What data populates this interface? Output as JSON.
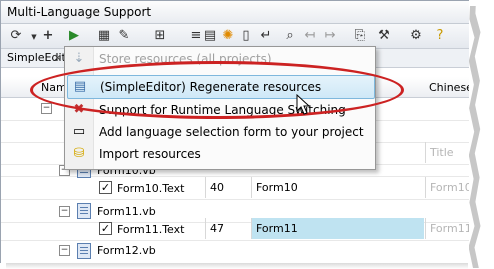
{
  "window": {
    "title": "Multi-Language Support"
  },
  "tab": {
    "label": "SimpleEditor",
    "close": "×"
  },
  "columns": {
    "name": "Name",
    "chinese": "Chinese"
  },
  "menu": {
    "items": [
      {
        "label": "Store resources (all projects)",
        "icon": "save-icon",
        "disabled": true
      },
      {
        "label": "(SimpleEditor) Regenerate resources",
        "icon": "regenerate-icon",
        "selected": true
      },
      {
        "label": "Support for Runtime Language Switching",
        "icon": "language-switch-icon"
      },
      {
        "label": "Add language selection form to your project",
        "icon": "add-form-icon"
      },
      {
        "label": "Import resources",
        "icon": "database-icon"
      }
    ]
  },
  "rows": [
    {
      "type": "file",
      "label": "Form10.vb"
    },
    {
      "type": "item",
      "label": "Form10.Text",
      "num": "40",
      "value": "Form10",
      "ghost": "Form10"
    },
    {
      "type": "file",
      "label": "Form11.vb"
    },
    {
      "type": "item",
      "label": "Form11.Text",
      "num": "47",
      "value": "Form11",
      "ghost": "Form11"
    },
    {
      "type": "file",
      "label": "Form12.vb"
    }
  ],
  "partial": {
    "title_ghost": "Title"
  },
  "colors": {
    "highlight_cell": "#bfe3f1",
    "menu_selected": "#cfe8f7",
    "ellipse": "#cc2222"
  }
}
